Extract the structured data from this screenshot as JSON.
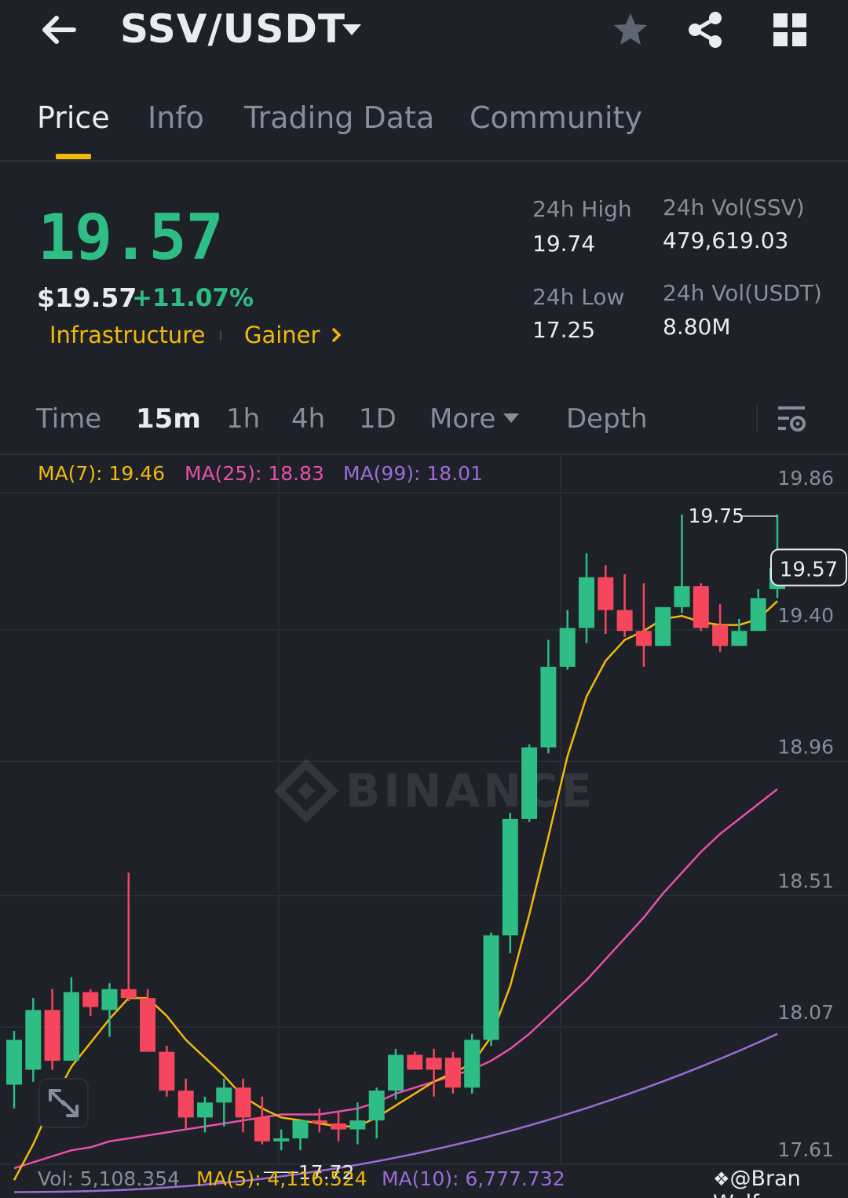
{
  "header": {
    "pair": "SSV/USDT",
    "icons": [
      "back-arrow-icon",
      "chevron-down-icon",
      "star-icon",
      "share-icon",
      "grid-icon"
    ]
  },
  "tabs": [
    {
      "label": "Price",
      "active": true
    },
    {
      "label": "Info",
      "active": false
    },
    {
      "label": "Trading Data",
      "active": false
    },
    {
      "label": "Community",
      "active": false
    }
  ],
  "ticker": {
    "last_price": "19.57",
    "usd_price": "$19.57",
    "change": "+11.07%",
    "tags": [
      "Infrastructure",
      "Gainer"
    ],
    "high_label": "24h High",
    "high_value": "19.74",
    "low_label": "24h Low",
    "low_value": "17.25",
    "vol_ssv_label": "24h Vol(SSV)",
    "vol_ssv_value": "479,619.03",
    "vol_usdt_label": "24h Vol(USDT)",
    "vol_usdt_value": "8.80M"
  },
  "intervals": {
    "items": [
      "Time",
      "15m",
      "1h",
      "4h",
      "1D",
      "More",
      "Depth"
    ],
    "active": "15m"
  },
  "indicators": {
    "ma7": "MA(7): 19.46",
    "ma25": "MA(25): 18.83",
    "ma99": "MA(99): 18.01",
    "vol": "Vol: 5,108.354",
    "vol_ma5": "MA(5): 4,116.524",
    "vol_ma10": "MA(10): 6,777.732"
  },
  "colors": {
    "up": "#2ebd85",
    "down": "#f6465d",
    "ma7": "#f0b90b",
    "ma25": "#e84fac",
    "ma99": "#9c6cd6",
    "accent": "#f0b90b"
  },
  "chart_data": {
    "type": "candlestick",
    "y_ticks": [
      "19.86",
      "19.40",
      "18.96",
      "18.51",
      "18.07",
      "17.61"
    ],
    "ylim": [
      17.61,
      19.86
    ],
    "current_price_label": "19.57",
    "high_marker": "19.75",
    "low_marker": "17.72",
    "watermark": "BINANCE",
    "candles": [
      {
        "o": 17.84,
        "h": 18.02,
        "l": 17.76,
        "c": 17.99
      },
      {
        "o": 17.89,
        "h": 18.13,
        "l": 17.85,
        "c": 18.09
      },
      {
        "o": 18.09,
        "h": 18.16,
        "l": 17.89,
        "c": 17.92
      },
      {
        "o": 17.92,
        "h": 18.2,
        "l": 17.92,
        "c": 18.15
      },
      {
        "o": 18.15,
        "h": 18.16,
        "l": 18.07,
        "c": 18.1
      },
      {
        "o": 18.09,
        "h": 18.18,
        "l": 18.0,
        "c": 18.16
      },
      {
        "o": 18.16,
        "h": 18.55,
        "l": 18.12,
        "c": 18.13
      },
      {
        "o": 18.13,
        "h": 18.16,
        "l": 17.96,
        "c": 17.95
      },
      {
        "o": 17.95,
        "h": 17.97,
        "l": 17.8,
        "c": 17.82
      },
      {
        "o": 17.82,
        "h": 17.86,
        "l": 17.69,
        "c": 17.73
      },
      {
        "o": 17.73,
        "h": 17.8,
        "l": 17.68,
        "c": 17.78
      },
      {
        "o": 17.78,
        "h": 17.86,
        "l": 17.7,
        "c": 17.83
      },
      {
        "o": 17.83,
        "h": 17.86,
        "l": 17.68,
        "c": 17.73
      },
      {
        "o": 17.73,
        "h": 17.8,
        "l": 17.64,
        "c": 17.65
      },
      {
        "o": 17.65,
        "h": 17.69,
        "l": 17.62,
        "c": 17.66
      },
      {
        "o": 17.66,
        "h": 17.72,
        "l": 17.62,
        "c": 17.72
      },
      {
        "o": 17.72,
        "h": 17.76,
        "l": 17.68,
        "c": 17.71
      },
      {
        "o": 17.71,
        "h": 17.75,
        "l": 17.65,
        "c": 17.69
      },
      {
        "o": 17.69,
        "h": 17.78,
        "l": 17.64,
        "c": 17.72
      },
      {
        "o": 17.72,
        "h": 17.83,
        "l": 17.66,
        "c": 17.82
      },
      {
        "o": 17.82,
        "h": 17.96,
        "l": 17.79,
        "c": 17.94
      },
      {
        "o": 17.94,
        "h": 17.95,
        "l": 17.89,
        "c": 17.89
      },
      {
        "o": 17.93,
        "h": 17.96,
        "l": 17.8,
        "c": 17.89
      },
      {
        "o": 17.93,
        "h": 17.95,
        "l": 17.81,
        "c": 17.83
      },
      {
        "o": 17.83,
        "h": 18.01,
        "l": 17.81,
        "c": 17.99
      },
      {
        "o": 17.99,
        "h": 18.35,
        "l": 17.97,
        "c": 18.34
      },
      {
        "o": 18.34,
        "h": 18.75,
        "l": 18.28,
        "c": 18.73
      },
      {
        "o": 18.73,
        "h": 18.98,
        "l": 18.72,
        "c": 18.97
      },
      {
        "o": 18.97,
        "h": 19.33,
        "l": 18.95,
        "c": 19.24
      },
      {
        "o": 19.24,
        "h": 19.43,
        "l": 19.23,
        "c": 19.37
      },
      {
        "o": 19.37,
        "h": 19.62,
        "l": 19.32,
        "c": 19.54
      },
      {
        "o": 19.54,
        "h": 19.58,
        "l": 19.35,
        "c": 19.43
      },
      {
        "o": 19.43,
        "h": 19.55,
        "l": 19.34,
        "c": 19.36
      },
      {
        "o": 19.36,
        "h": 19.52,
        "l": 19.24,
        "c": 19.31
      },
      {
        "o": 19.31,
        "h": 19.43,
        "l": 19.31,
        "c": 19.44
      },
      {
        "o": 19.44,
        "h": 19.75,
        "l": 19.42,
        "c": 19.51
      },
      {
        "o": 19.51,
        "h": 19.52,
        "l": 19.36,
        "c": 19.37
      },
      {
        "o": 19.38,
        "h": 19.45,
        "l": 19.29,
        "c": 19.31
      },
      {
        "o": 19.31,
        "h": 19.4,
        "l": 19.31,
        "c": 19.36
      },
      {
        "o": 19.36,
        "h": 19.5,
        "l": 19.36,
        "c": 19.47
      },
      {
        "o": 19.5,
        "h": 19.75,
        "l": 19.47,
        "c": 19.57
      }
    ],
    "ma7": [
      17.52,
      17.64,
      17.78,
      17.9,
      17.98,
      18.06,
      18.13,
      18.13,
      18.07,
      17.99,
      17.93,
      17.87,
      17.8,
      17.76,
      17.73,
      17.72,
      17.71,
      17.7,
      17.7,
      17.73,
      17.77,
      17.81,
      17.85,
      17.88,
      17.91,
      18.0,
      18.17,
      18.41,
      18.67,
      18.94,
      19.14,
      19.26,
      19.33,
      19.36,
      19.4,
      19.41,
      19.39,
      19.38,
      19.38,
      19.4,
      19.46
    ],
    "ma25": [
      17.56,
      17.58,
      17.6,
      17.62,
      17.63,
      17.65,
      17.66,
      17.67,
      17.68,
      17.69,
      17.7,
      17.71,
      17.72,
      17.73,
      17.74,
      17.74,
      17.74,
      17.75,
      17.76,
      17.78,
      17.81,
      17.83,
      17.85,
      17.87,
      17.89,
      17.92,
      17.96,
      18.01,
      18.07,
      18.13,
      18.19,
      18.26,
      18.33,
      18.4,
      18.48,
      18.55,
      18.62,
      18.68,
      18.73,
      18.78,
      18.83
    ]
  }
}
